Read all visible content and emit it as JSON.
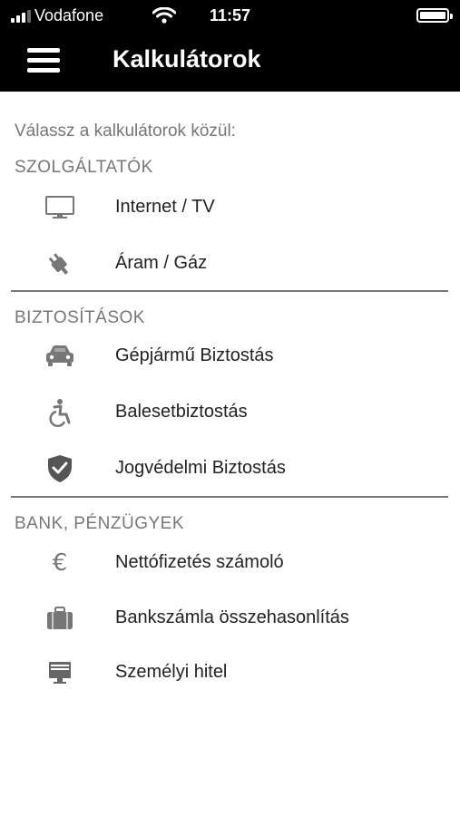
{
  "status_bar": {
    "carrier": "Vodafone",
    "time": "11:57"
  },
  "app_bar": {
    "title": "Kalkulátorok"
  },
  "intro_text": "Válassz a kalkulátorok közül:",
  "sections": [
    {
      "heading": "SZOLGÁLTATÓK",
      "items": [
        {
          "label": "Internet / TV",
          "icon": "monitor-icon"
        },
        {
          "label": "Áram / Gáz",
          "icon": "plug-icon"
        }
      ]
    },
    {
      "heading": "BIZTOSÍTÁSOK",
      "items": [
        {
          "label": "Gépjármű Biztostás",
          "icon": "car-icon"
        },
        {
          "label": "Balesetbiztostás",
          "icon": "wheelchair-icon"
        },
        {
          "label": "Jogvédelmi Biztostás",
          "icon": "shield-check-icon"
        }
      ]
    },
    {
      "heading": "BANK, PÉNZÜGYEK",
      "items": [
        {
          "label": "Nettófizetés számoló",
          "icon": "euro-icon"
        },
        {
          "label": "Bankszámla összehasonlítás",
          "icon": "briefcase-icon"
        },
        {
          "label": "Személyi hitel",
          "icon": "bank-card-icon"
        }
      ]
    }
  ],
  "colors": {
    "bar_background": "#000000",
    "icon_gray": "#666666",
    "heading_gray": "#777777",
    "text": "#222222"
  }
}
